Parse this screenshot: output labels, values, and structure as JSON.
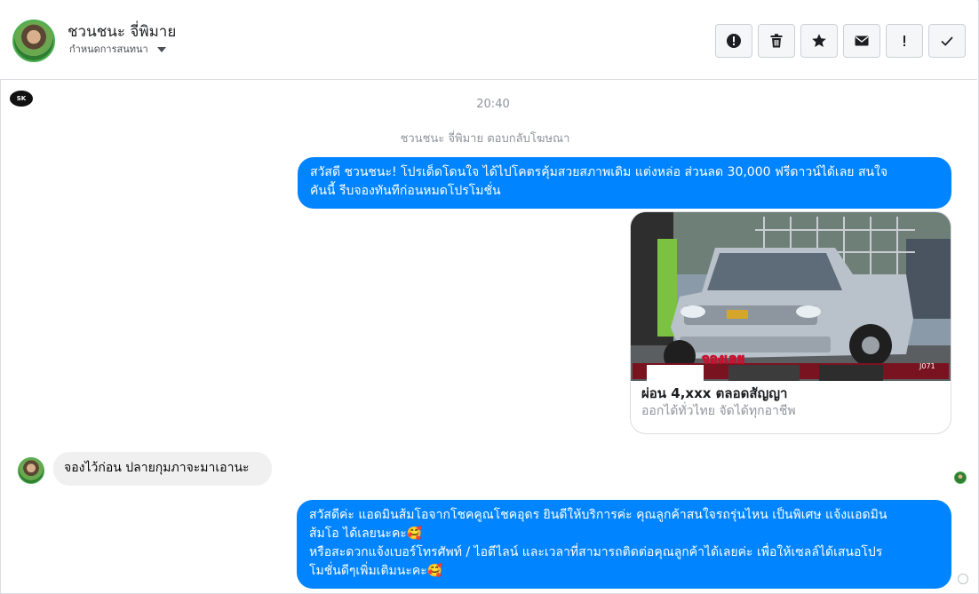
{
  "header": {
    "contact_name": "ชวนชนะ จี่พิมาย",
    "subtitle": "กำหนดการสนทนา",
    "toolbar": [
      {
        "name": "report-button",
        "icon": "alert-circle-icon"
      },
      {
        "name": "delete-button",
        "icon": "trash-icon"
      },
      {
        "name": "star-button",
        "icon": "star-icon"
      },
      {
        "name": "mail-button",
        "icon": "envelope-icon"
      },
      {
        "name": "important-button",
        "icon": "exclamation-icon"
      },
      {
        "name": "done-button",
        "icon": "check-icon"
      }
    ]
  },
  "chat": {
    "page_logo_text": "SK",
    "timestamp": "20:40",
    "reply_note": "ชวนชนะ จี่พิมาย ตอบกลับโฆษณา",
    "msg1_line1": "สวัสดี ชวนชนะ! โปรเด็ดโดนใจ ได้ไปโคตรคุ้มสวยสภาพเดิม แต่งหล่อ  ส่วนลด 30,000 ฟรีดาวน์ได้เลย  สนใจ",
    "msg1_line2": "คันนี้ รีบจองทันทีก่อนหมดโปรโมชั่น",
    "card": {
      "title": "ผ่อน 4,xxx ตลอดสัญญา",
      "subtitle": "ออกได้ทั่วไทย จัดได้ทุกอาชีพ",
      "sticker_text": "จองเลย",
      "plate_text": "J071"
    },
    "msg2": "จองไว้ก่อน ปลายกุมภาจะมาเอานะ",
    "msg3_line1": "สวัสดีค่ะ แอดมินส้มโอจากโชคคูณโชคอุดร ยินดีให้บริการค่ะ   คุณลูกค้าสนใจรถรุ่นไหน เป็นพิเศษ แจ้งแอดมิน",
    "msg3_line2": "ส้มโอ ได้เลยนะคะ🥰",
    "msg3_line3": "หรือสะดวกแจ้งเบอร์โทรศัพท์ / ไอดีไลน์ และเวลาที่สามารถติดต่อคุณลูกค้าได้เลยค่ะ เพื่อให้เซลล์ได้เสนอโปร",
    "msg3_line4": "โมชั่นดีๆเพิ่มเติมนะคะ🥰"
  },
  "colors": {
    "accent": "#0084ff",
    "incoming_bubble": "#f1f0f0",
    "meta_text": "#90949c"
  }
}
